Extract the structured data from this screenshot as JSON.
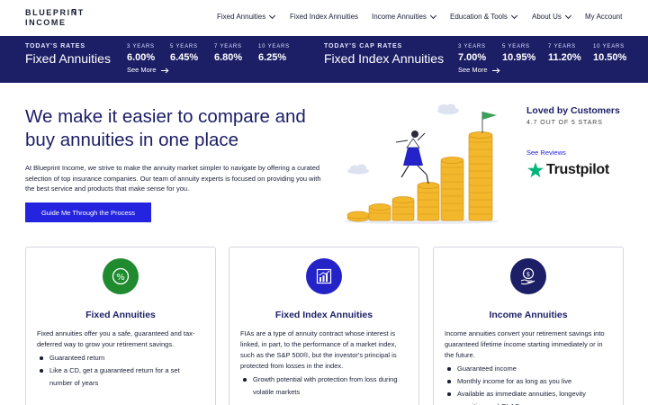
{
  "nav": {
    "logo_line1": "BLUEPRINT",
    "logo_line2": "INCOME",
    "items": [
      {
        "label": "Fixed Annuities",
        "has_dropdown": true
      },
      {
        "label": "Fixed Index Annuities",
        "has_dropdown": false
      },
      {
        "label": "Income Annuities",
        "has_dropdown": true
      },
      {
        "label": "Education & Tools",
        "has_dropdown": true
      },
      {
        "label": "About Us",
        "has_dropdown": true
      },
      {
        "label": "My Account",
        "has_dropdown": false
      }
    ]
  },
  "rates_bar": {
    "background": "#1c1e66",
    "fixed": {
      "label": "TODAY'S RATES",
      "title": "Fixed Annuities",
      "terms": [
        "3 YEARS",
        "5 YEARS",
        "7 YEARS",
        "10 YEARS"
      ],
      "rates": [
        "6.00%",
        "6.45%",
        "6.80%",
        "6.25%"
      ],
      "see_more": "See More"
    },
    "index": {
      "label": "TODAY'S CAP RATES",
      "title": "Fixed Index Annuities",
      "terms": [
        "3 YEARS",
        "5 YEARS",
        "7 YEARS",
        "10 YEARS"
      ],
      "rates": [
        "7.00%",
        "10.95%",
        "11.20%",
        "10.50%"
      ],
      "see_more": "See More"
    }
  },
  "hero": {
    "title": "We make it easier to compare and buy annuities in one place",
    "text": "At Blueprint Income, we strive to make the annuity market simpler to navigate by offering a curated selection of top insurance companies. Our team of annuity experts is focused on providing you with the best service and products that make sense for you.",
    "cta": "Guide Me Through the Process",
    "accent": "#2323e0"
  },
  "social_proof": {
    "title": "Loved by Customers",
    "rating": "4.7 OUT OF 5 STARS",
    "reviews_link": "See Reviews",
    "brand": "Trustpilot",
    "brand_color": "#00b67a"
  },
  "cards": [
    {
      "icon": "percent-coin-icon",
      "icon_color": "#1f8a2e",
      "title": "Fixed Annuities",
      "body": "Fixed annuities offer you a safe, guaranteed and tax-deferred way to grow your retirement savings.",
      "bullets": [
        "Guaranteed return",
        "Like a CD, get a guaranteed return for a set number of years"
      ]
    },
    {
      "icon": "growth-chart-icon",
      "icon_color": "#2323c8",
      "title": "Fixed Index Annuities",
      "body": "FIAs are a type of annuity contract whose interest is linked, in part, to the performance of a market index, such as the S&P 500®, but the investor's principal is protected from losses in the index.",
      "bullets": [
        "Growth potential with protection from loss during volatile markets"
      ]
    },
    {
      "icon": "dollar-hand-icon",
      "icon_color": "#1c1e66",
      "title": "Income Annuities",
      "body": "Income annuities convert your retirement savings into guaranteed lifetime income starting immediately or in the future.",
      "bullets": [
        "Guaranteed income",
        "Monthly income for as long as you live",
        "Available as immediate annuities, longevity annuities, and QLACs"
      ]
    }
  ]
}
